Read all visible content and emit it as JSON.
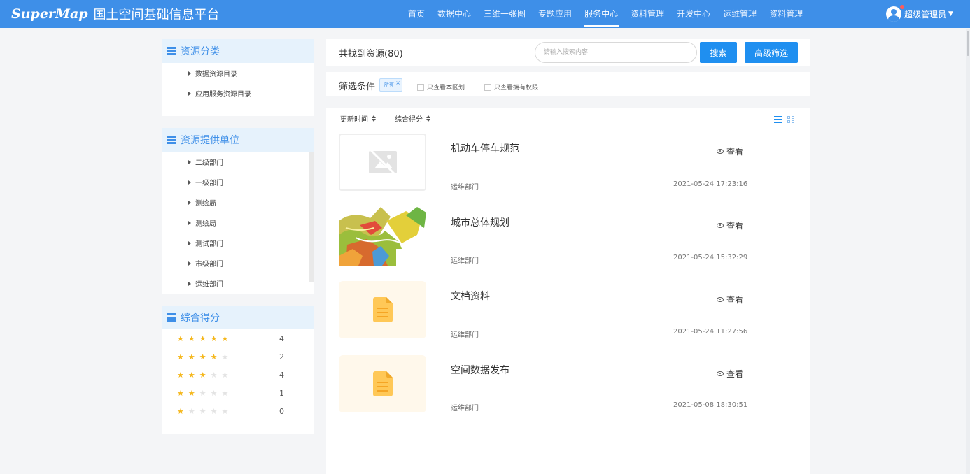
{
  "header": {
    "brand": "SuperMap",
    "title": "国土空间基础信息平台",
    "nav": [
      "首页",
      "数据中心",
      "三维一张图",
      "专题应用",
      "服务中心",
      "资料管理",
      "开发中心",
      "运维管理",
      "资料管理"
    ],
    "active_nav": "服务中心",
    "user": "超级管理员"
  },
  "sidebar": {
    "category": {
      "title": "资源分类",
      "items": [
        "数据资源目录",
        "应用服务资源目录"
      ]
    },
    "provider": {
      "title": "资源提供单位",
      "items": [
        "二级部门",
        "一级部门",
        "测绘局",
        "测绘局",
        "测试部门",
        "市级部门",
        "运维部门"
      ]
    },
    "score": {
      "title": "综合得分",
      "rows": [
        {
          "stars": 5,
          "count": "4"
        },
        {
          "stars": 4,
          "count": "2"
        },
        {
          "stars": 3,
          "count": "4"
        },
        {
          "stars": 2,
          "count": "1"
        },
        {
          "stars": 1,
          "count": "0"
        }
      ]
    }
  },
  "search": {
    "found_label": "共找到资源(80)",
    "placeholder": "请输入搜索内容",
    "search_button": "搜索",
    "advanced_button": "高级筛选"
  },
  "filter": {
    "label": "筛选条件",
    "tag": "所有",
    "checkbox_region": "只查看本区划",
    "checkbox_permission": "只查看拥有权限"
  },
  "sort": {
    "update_time": "更新时间",
    "score": "综合得分"
  },
  "colors": {
    "primary": "#3e8fe8",
    "button": "#1f8ff0",
    "star": "#f5b71b"
  },
  "results": [
    {
      "title": "机动车停车规范",
      "dept": "运维部门",
      "date": "2021-05-24 17:23:16",
      "view": "查看",
      "thumb": "image-placeholder-icon"
    },
    {
      "title": "城市总体规划",
      "dept": "运维部门",
      "date": "2021-05-24 15:32:29",
      "view": "查看",
      "thumb": "map-thumbnail"
    },
    {
      "title": "文档资料",
      "dept": "运维部门",
      "date": "2021-05-24 11:27:56",
      "view": "查看",
      "thumb": "document-icon"
    },
    {
      "title": "空间数据发布",
      "dept": "运维部门",
      "date": "2021-05-08 18:30:51",
      "view": "查看",
      "thumb": "document-icon"
    }
  ]
}
